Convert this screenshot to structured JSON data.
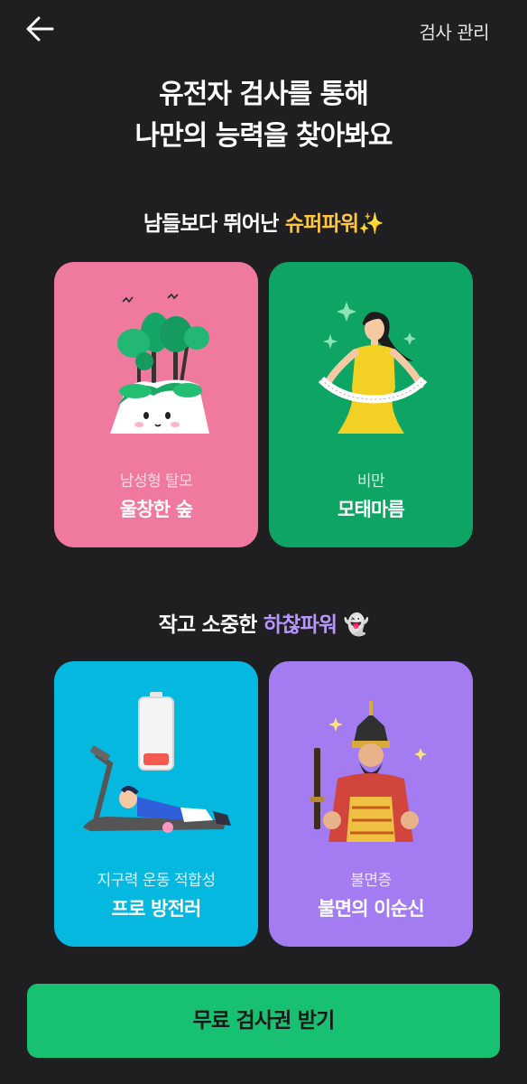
{
  "header": {
    "back_icon": "arrow-left-icon",
    "manage_label": "검사 관리"
  },
  "headline": {
    "line1": "유전자 검사를 통해",
    "line2": "나만의 능력을 찾아봐요"
  },
  "superpower_section": {
    "prefix": "남들보다 뛰어난 ",
    "highlight": "슈퍼파워",
    "emoji": "✨",
    "highlight_color": "#ffc53d",
    "cards": [
      {
        "category": "남성형 탈모",
        "title": "울창한 숲",
        "bg_color": "#f07a9e",
        "illustration": "forest-hill-illustration"
      },
      {
        "category": "비만",
        "title": "모태마름",
        "bg_color": "#0ea463",
        "illustration": "woman-measuring-tape-illustration"
      }
    ]
  },
  "weakpower_section": {
    "prefix": "작고 소중한 ",
    "highlight": "하찮파워",
    "emoji": "👻",
    "highlight_color": "#b794ff",
    "cards": [
      {
        "category": "지구력 운동 적합성",
        "title": "프로 방전러",
        "bg_color": "#05b8e0",
        "illustration": "tired-runner-treadmill-illustration"
      },
      {
        "category": "불면증",
        "title": "불면의 이순신",
        "bg_color": "#a37cf1",
        "illustration": "general-yi-sun-sin-illustration"
      }
    ]
  },
  "cta": {
    "label": "무료 검사권 받기",
    "color": "#18c172"
  }
}
